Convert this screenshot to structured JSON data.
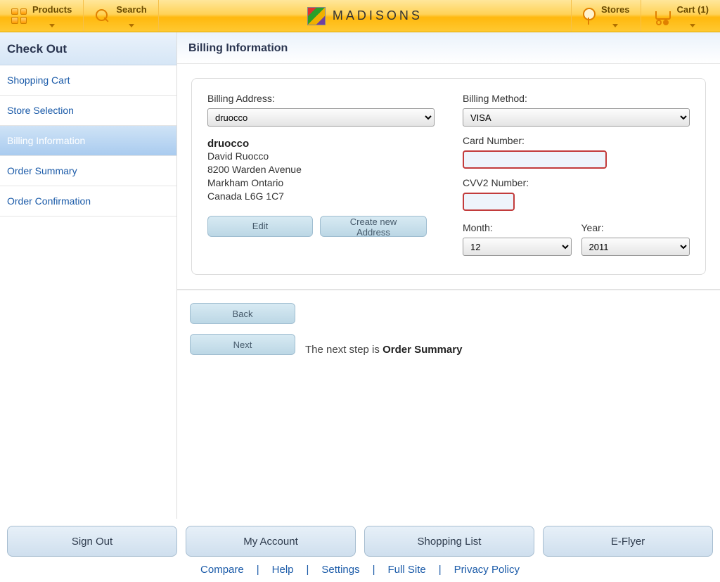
{
  "topnav": {
    "products": "Products",
    "search": "Search",
    "brand": "MADISONS",
    "stores": "Stores",
    "cart": "Cart (1)"
  },
  "sidebar": {
    "title": "Check Out",
    "items": [
      {
        "label": "Shopping Cart"
      },
      {
        "label": "Store Selection"
      },
      {
        "label": "Billing Information"
      },
      {
        "label": "Order Summary"
      },
      {
        "label": "Order Confirmation"
      }
    ]
  },
  "content": {
    "header": "Billing Information",
    "billing_address_label": "Billing Address:",
    "billing_address_value": "druocco",
    "addr": {
      "name": "druocco",
      "full_name": "David Ruocco",
      "street": "8200 Warden Avenue",
      "city": "Markham Ontario",
      "country": "Canada L6G 1C7"
    },
    "edit_btn": "Edit",
    "create_btn": "Create new Address",
    "billing_method_label": "Billing Method:",
    "billing_method_value": "VISA",
    "card_label": "Card Number:",
    "cvv_label": "CVV2 Number:",
    "month_label": "Month:",
    "month_value": "12",
    "year_label": "Year:",
    "year_value": "2011",
    "back_btn": "Back",
    "next_btn": "Next",
    "next_text_prefix": "The next step is ",
    "next_text_strong": "Order Summary"
  },
  "footer": {
    "buttons": [
      "Sign Out",
      "My Account",
      "Shopping List",
      "E-Flyer"
    ],
    "links": [
      "Compare",
      "Help",
      "Settings",
      "Full Site",
      "Privacy Policy"
    ]
  }
}
